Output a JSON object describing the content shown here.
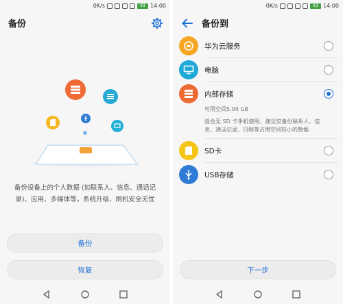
{
  "status": {
    "speed": "0K/s",
    "time": "14:00",
    "battery": "93"
  },
  "left": {
    "title": "备份",
    "description": "备份设备上的个人数据 (如联系人、信息、通话记录)、应用、多媒体等，系统升级、刷机安全无忧",
    "backup_label": "备份",
    "restore_label": "恢复"
  },
  "right": {
    "title": "备份到",
    "options": [
      {
        "label": "华为云服务",
        "selected": false,
        "color": "#f5a623"
      },
      {
        "label": "电脑",
        "selected": false,
        "color": "#1fa8d8"
      },
      {
        "label": "内部存储",
        "selected": true,
        "color": "#ee6a33"
      },
      {
        "label": "SD卡",
        "selected": false,
        "color": "#f5c518"
      },
      {
        "label": "USB存储",
        "selected": false,
        "color": "#2f7bd6"
      }
    ],
    "internal_available": "可用空间5.99 GB",
    "internal_note": "适合无 SD 卡手机使用，建议仅备份联系人、信息、通话记录、日程等占用空间较小的数据",
    "next_label": "下一步"
  },
  "colors": {
    "accent": "#1e6fd6"
  }
}
